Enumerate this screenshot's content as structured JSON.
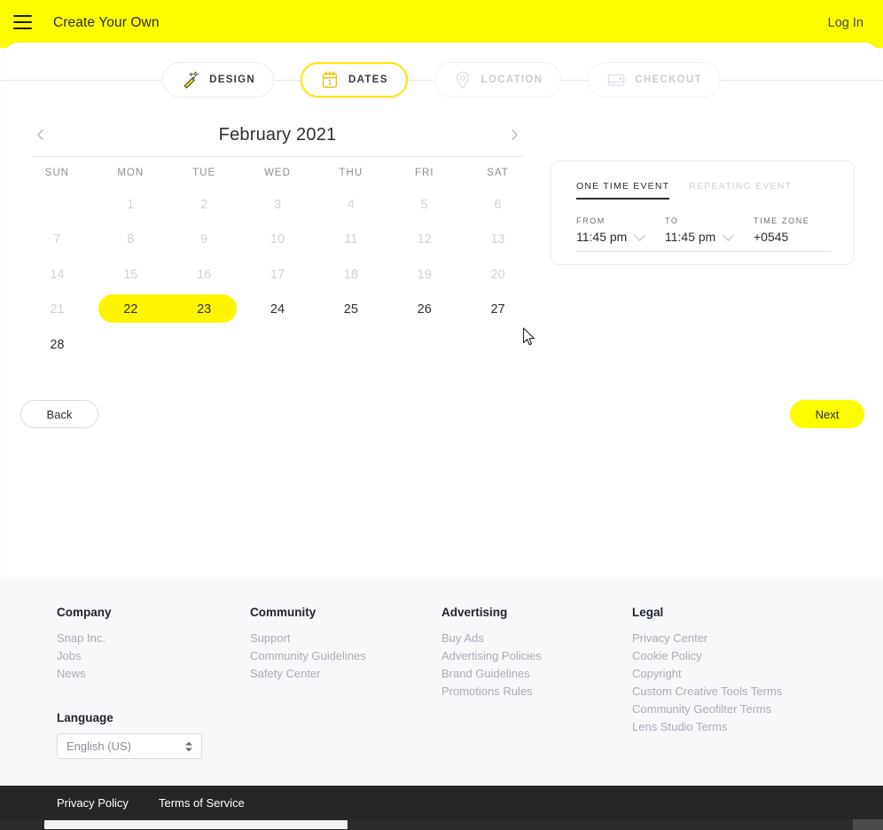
{
  "header": {
    "menu_icon": "hamburger-icon",
    "title": "Create Your Own",
    "login_label": "Log In",
    "background_color": "#FFFC00"
  },
  "stepper": {
    "steps": [
      {
        "label": "DESIGN",
        "icon": "magic-wand-icon",
        "state": "done"
      },
      {
        "label": "DATES",
        "icon": "calendar-icon",
        "state": "active"
      },
      {
        "label": "LOCATION",
        "icon": "map-pin-icon",
        "state": "disabled"
      },
      {
        "label": "CHECKOUT",
        "icon": "credit-card-icon",
        "state": "disabled"
      }
    ],
    "active_color": "#FFE600"
  },
  "calendar": {
    "prev_icon": "chevron-left-icon",
    "next_icon": "chevron-right-icon",
    "month_title": "February 2021",
    "weekdays": [
      "SUN",
      "MON",
      "TUE",
      "WED",
      "THU",
      "FRI",
      "SAT"
    ],
    "weeks": [
      [
        {
          "d": "",
          "state": "empty"
        },
        {
          "d": "1",
          "state": "muted"
        },
        {
          "d": "2",
          "state": "muted"
        },
        {
          "d": "3",
          "state": "muted"
        },
        {
          "d": "4",
          "state": "muted"
        },
        {
          "d": "5",
          "state": "muted"
        },
        {
          "d": "6",
          "state": "muted"
        }
      ],
      [
        {
          "d": "7",
          "state": "muted"
        },
        {
          "d": "8",
          "state": "muted"
        },
        {
          "d": "9",
          "state": "muted"
        },
        {
          "d": "10",
          "state": "muted"
        },
        {
          "d": "11",
          "state": "muted"
        },
        {
          "d": "12",
          "state": "muted"
        },
        {
          "d": "13",
          "state": "muted"
        }
      ],
      [
        {
          "d": "14",
          "state": "muted"
        },
        {
          "d": "15",
          "state": "muted"
        },
        {
          "d": "16",
          "state": "muted"
        },
        {
          "d": "17",
          "state": "muted"
        },
        {
          "d": "18",
          "state": "muted"
        },
        {
          "d": "19",
          "state": "muted"
        },
        {
          "d": "20",
          "state": "muted"
        }
      ],
      [
        {
          "d": "21",
          "state": "muted"
        },
        {
          "d": "22",
          "state": "selected"
        },
        {
          "d": "23",
          "state": "selected"
        },
        {
          "d": "24",
          "state": "enabled"
        },
        {
          "d": "25",
          "state": "enabled"
        },
        {
          "d": "26",
          "state": "enabled"
        },
        {
          "d": "27",
          "state": "enabled"
        }
      ],
      [
        {
          "d": "28",
          "state": "enabled"
        },
        {
          "d": "",
          "state": "empty"
        },
        {
          "d": "",
          "state": "empty"
        },
        {
          "d": "",
          "state": "empty"
        },
        {
          "d": "",
          "state": "empty"
        },
        {
          "d": "",
          "state": "empty"
        },
        {
          "d": "",
          "state": "empty"
        }
      ]
    ],
    "selection": {
      "start_day": "22",
      "end_day": "23",
      "highlight_color": "#FFF500"
    }
  },
  "event_panel": {
    "tabs": [
      {
        "label": "ONE TIME EVENT",
        "state": "active"
      },
      {
        "label": "REPEATING EVENT",
        "state": "inactive"
      }
    ],
    "from": {
      "label": "FROM",
      "value": "11:45 pm",
      "chevron": "chevron-down-icon"
    },
    "to": {
      "label": "TO",
      "value": "11:45 pm",
      "chevron": "chevron-down-icon"
    },
    "timezone": {
      "label": "TIME ZONE",
      "value": "+0545"
    }
  },
  "actions": {
    "back_label": "Back",
    "next_label": "Next",
    "next_color": "#FFFC00"
  },
  "footer": {
    "columns": [
      {
        "heading": "Company",
        "links": [
          "Snap Inc.",
          "Jobs",
          "News"
        ]
      },
      {
        "heading": "Community",
        "links": [
          "Support",
          "Community Guidelines",
          "Safety Center"
        ]
      },
      {
        "heading": "Advertising",
        "links": [
          "Buy Ads",
          "Advertising Policies",
          "Brand Guidelines",
          "Promotions Rules"
        ]
      },
      {
        "heading": "Legal",
        "links": [
          "Privacy Center",
          "Cookie Policy",
          "Copyright",
          "Custom Creative Tools Terms",
          "Community Geofilter Terms",
          "Lens Studio Terms"
        ]
      }
    ],
    "language": {
      "heading": "Language",
      "value": "English (US)",
      "stepper_icon": "updown-spinner-icon"
    }
  },
  "bottom_bar": {
    "privacy_label": "Privacy Policy",
    "terms_label": "Terms of Service",
    "background_color": "#262626"
  }
}
